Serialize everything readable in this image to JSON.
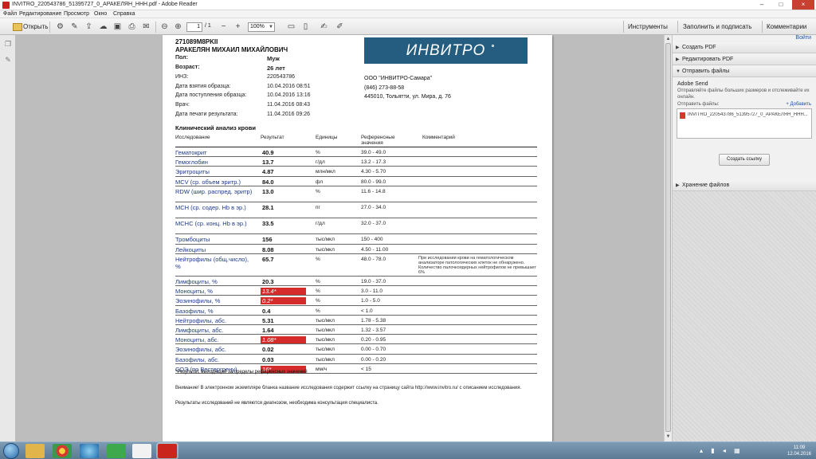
{
  "window": {
    "title": "INVITRO_220543786_51395727_0_АРАКЕЛЯН_ННН.pdf - Adobe Reader",
    "min": "–",
    "max": "□",
    "close": "×"
  },
  "menu": [
    "Файл",
    "Редактирование",
    "Просмотр",
    "Окно",
    "Справка"
  ],
  "toolbar": {
    "open_label": "Открыть",
    "page_current": "1",
    "page_total": "/ 1",
    "zoom": "100%",
    "tools": "Инструменты",
    "fill_sign": "Заполнить и подписать",
    "comments": "Комментарии"
  },
  "right_panel": {
    "sign_in": "Войти",
    "sections": [
      "Создать PDF",
      "Редактировать PDF",
      "Отправить файлы",
      "Хранение файлов"
    ],
    "send_title": "Adobe Send",
    "send_desc": "Отправляйте файлы больших размеров и отслеживайте их онлайн.",
    "files_label": "Отправить файлы:",
    "add_link": "+ Добавить",
    "file_name": "INVITRO_220543786_51395727_0_АРАКЕЛЯН_ННН...",
    "link_button": "Создать ссылку"
  },
  "document": {
    "id": "271089M8PKII",
    "patient": "АРАКЕЛЯН МИХАИЛ МИХАЙЛОВИЧ",
    "fields": [
      {
        "label": "Пол:",
        "value": "Муж",
        "bold": true
      },
      {
        "label": "Возраст:",
        "value": "26 лет",
        "bold": true
      },
      {
        "label": "ИНЗ:",
        "value": "220543786",
        "bold": false
      },
      {
        "label": "Дата взятия образца:",
        "value": "10.04.2016 08:51",
        "bold": false
      },
      {
        "label": "Дата поступления образца:",
        "value": "10.04.2016 13:16",
        "bold": false
      },
      {
        "label": "Врач:",
        "value": "11.04.2016 08:43",
        "bold": false
      },
      {
        "label": "Дата печати результата:",
        "value": "11.04.2016 09:26",
        "bold": false
      }
    ],
    "logo_text": "ИНВИТРО",
    "org": "ООО \"ИНВИТРО-Самара\"",
    "phone": "(846) 273-88-58",
    "address": "445010, Тольятти, ул. Мира, д. 76",
    "section_title": "Клинический анализ крови",
    "table_headers": [
      "Исследование",
      "Результат",
      "Единицы",
      "Референсные значения",
      "Комментарий"
    ],
    "rows": [
      {
        "name": "Гематокрит",
        "value": "40.9",
        "unit": "%",
        "ref": "39.0 - 49.0",
        "flag": false,
        "lines": 1
      },
      {
        "name": "Гемоглобин",
        "value": "13.7",
        "unit": "г/дл",
        "ref": "13.2 - 17.3",
        "flag": false,
        "lines": 1
      },
      {
        "name": "Эритроциты",
        "value": "4.87",
        "unit": "млн/мкл",
        "ref": "4.30 - 5.70",
        "flag": false,
        "lines": 1
      },
      {
        "name": "MCV (ср. объем эритр.)",
        "value": "84.0",
        "unit": "фл",
        "ref": "80.0 - 99.0",
        "flag": false,
        "lines": 1
      },
      {
        "name": "RDW (шир. распред. эритр)",
        "value": "13.0",
        "unit": "%",
        "ref": "11.6 - 14.8",
        "flag": false,
        "lines": 2
      },
      {
        "name": "MCH (ср. содер. Hb в эр.)",
        "value": "28.1",
        "unit": "пг",
        "ref": "27.0 - 34.0",
        "flag": false,
        "lines": 2
      },
      {
        "name": "MCHC (ср. конц. Hb в эр.)",
        "value": "33.5",
        "unit": "г/дл",
        "ref": "32.0 - 37.0",
        "flag": false,
        "lines": 2
      },
      {
        "name": "Тромбоциты",
        "value": "156",
        "unit": "тыс/мкл",
        "ref": "150 - 400",
        "flag": false,
        "lines": 1
      },
      {
        "name": "Лейкоциты",
        "value": "8.08",
        "unit": "тыс/мкл",
        "ref": "4.50 - 11.00",
        "flag": false,
        "lines": 1
      },
      {
        "name": "Нейтрофилы (общ.число), %",
        "value": "65.7",
        "unit": "%",
        "ref": "48.0 - 78.0",
        "flag": false,
        "lines": 3,
        "comment": "При исследовании крови на гематологическом анализаторе патологических клеток не обнаружено. Количество палочкоядерных нейтрофилов не превышает 6%"
      },
      {
        "name": "Лимфоциты, %",
        "value": "20.3",
        "unit": "%",
        "ref": "19.0 - 37.0",
        "flag": false,
        "lines": 1
      },
      {
        "name": "Моноциты, %",
        "value": "13.4*",
        "unit": "%",
        "ref": "3.0 - 11.0",
        "flag": true,
        "lines": 1
      },
      {
        "name": "Эозинофилы, %",
        "value": "0.2*",
        "unit": "%",
        "ref": "1.0 - 5.0",
        "flag": true,
        "lines": 1
      },
      {
        "name": "Базофилы, %",
        "value": "0.4",
        "unit": "%",
        "ref": "< 1.0",
        "flag": false,
        "lines": 1
      },
      {
        "name": "Нейтрофилы, абс.",
        "value": "5.31",
        "unit": "тыс/мкл",
        "ref": "1.78 - 5.38",
        "flag": false,
        "lines": 1
      },
      {
        "name": "Лимфоциты, абс.",
        "value": "1.64",
        "unit": "тыс/мкл",
        "ref": "1.32 - 3.57",
        "flag": false,
        "lines": 1
      },
      {
        "name": "Моноциты, абс.",
        "value": "1.08*",
        "unit": "тыс/мкл",
        "ref": "0.20 - 0.95",
        "flag": true,
        "lines": 1
      },
      {
        "name": "Эозинофилы, абс.",
        "value": "0.02",
        "unit": "тыс/мкл",
        "ref": "0.00 - 0.70",
        "flag": false,
        "lines": 1
      },
      {
        "name": "Базофилы, абс.",
        "value": "0.03",
        "unit": "тыс/мкл",
        "ref": "0.00 - 0.20",
        "flag": false,
        "lines": 1
      },
      {
        "name": "СОЭ (по Вестергрену)",
        "value": "16*",
        "unit": "мм/ч",
        "ref": "< 15",
        "flag": true,
        "lines": 1
      }
    ],
    "footnote": "*Результат, выходящий за пределы референсных значений",
    "notice": "Внимание! В электронном экземпляре бланка название исследования содержит ссылку на страницу сайта http://www.invitro.ru/ с описанием исследования.",
    "notice2": "Результаты исследований не являются диагнозом, необходима консультация специалиста."
  },
  "taskbar": {
    "time": "11:09",
    "date": "12.04.2016"
  },
  "colors": {
    "flag": "#d62b2b",
    "logo": "#255d80",
    "test_name": "#1d3a8a"
  }
}
